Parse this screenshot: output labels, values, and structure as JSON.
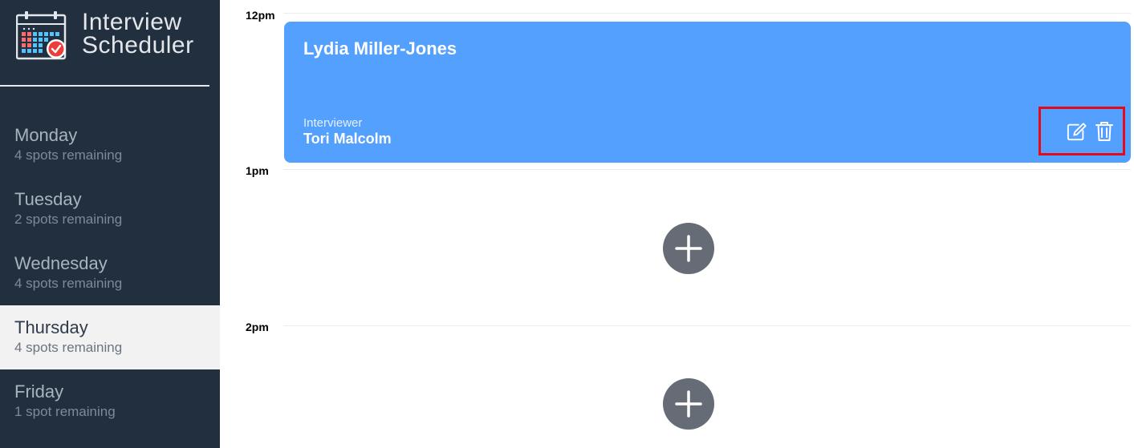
{
  "brand": {
    "title_line1": "Interview",
    "title_line2": "Scheduler",
    "logo_icon": "calendar-check-icon"
  },
  "days": [
    {
      "name": "Monday",
      "spots": "4 spots remaining",
      "selected": false
    },
    {
      "name": "Tuesday",
      "spots": "2 spots remaining",
      "selected": false
    },
    {
      "name": "Wednesday",
      "spots": "4 spots remaining",
      "selected": false
    },
    {
      "name": "Thursday",
      "spots": "4 spots remaining",
      "selected": true
    },
    {
      "name": "Friday",
      "spots": "1 spot remaining",
      "selected": false
    }
  ],
  "schedule": {
    "times": [
      "12pm",
      "1pm",
      "2pm"
    ],
    "appointment": {
      "student": "Lydia Miller-Jones",
      "interviewer_label": "Interviewer",
      "interviewer": "Tori Malcolm",
      "edit_icon": "edit-icon",
      "delete_icon": "trash-icon"
    },
    "add_icon": "plus-icon"
  },
  "colors": {
    "sidebar_bg": "#222f3e",
    "selected_day_bg": "#f2f2f2",
    "appointment_bg": "#54a0ff",
    "add_button_bg": "#666c75",
    "highlight_box": "#e30a1a"
  }
}
